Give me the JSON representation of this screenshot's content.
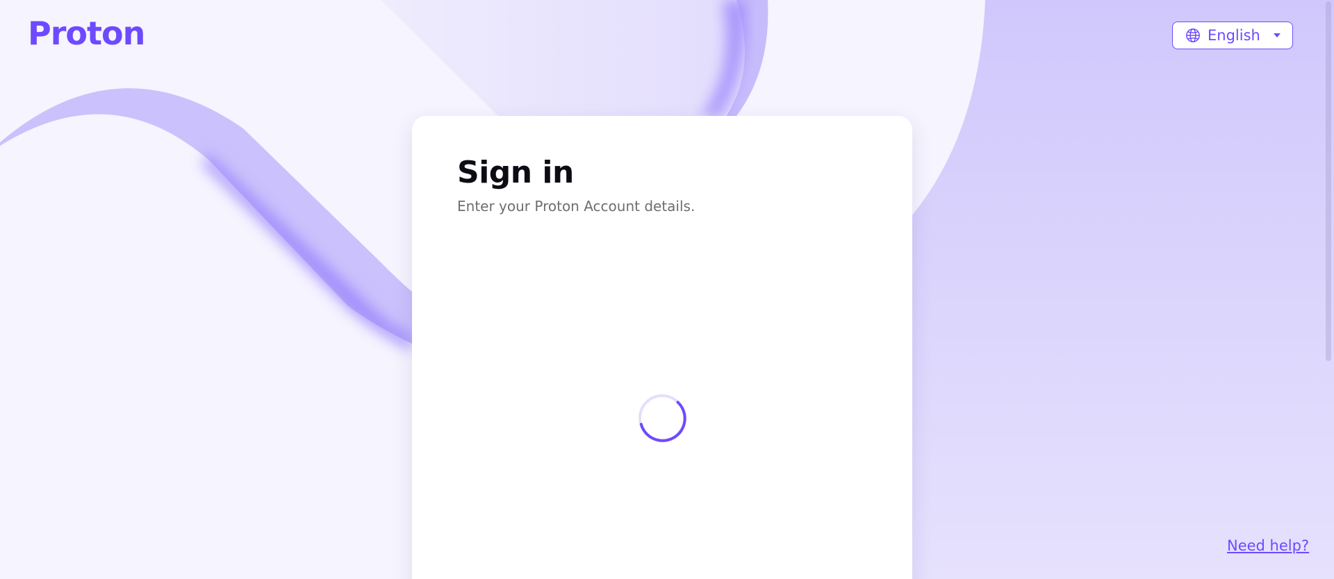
{
  "brand": {
    "logo_text": "Proton",
    "accent_color": "#6d4aff"
  },
  "header": {
    "language_selector": {
      "icon": "globe-icon",
      "label": "English",
      "caret_icon": "caret-down-icon"
    }
  },
  "signin_card": {
    "title": "Sign in",
    "subtitle": "Enter your Proton Account details.",
    "loading_indicator": "spinner-icon"
  },
  "footer": {
    "help_link": "Need help?"
  }
}
